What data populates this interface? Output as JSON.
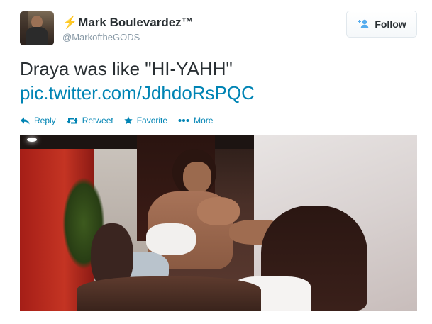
{
  "user": {
    "display_name_prefix": "⚡",
    "display_name": "Mark Boulevardez™",
    "screen_name": "@MarkoftheGODS"
  },
  "follow_button": {
    "label": "Follow"
  },
  "tweet": {
    "text": "Draya was like \"HI-YAHH\"",
    "link": "pic.twitter.com/JdhdoRsPQC"
  },
  "actions": [
    {
      "label": "Reply",
      "icon": "reply-icon"
    },
    {
      "label": "Retweet",
      "icon": "retweet-icon"
    },
    {
      "label": "Favorite",
      "icon": "star-icon"
    },
    {
      "label": "More",
      "icon": "more-dots-icon"
    }
  ],
  "colors": {
    "link": "#0084b4",
    "text": "#292f33",
    "muted": "#8899a6"
  }
}
